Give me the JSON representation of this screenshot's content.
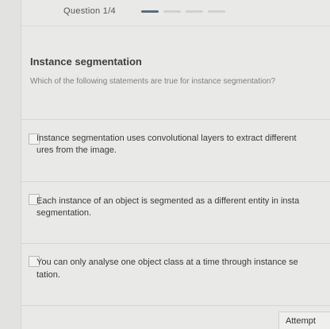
{
  "header": {
    "question_counter": "Question 1/4",
    "progress": {
      "total_steps": 4,
      "current_step": 1
    }
  },
  "content": {
    "title": "Instance segmentation",
    "question": "Which of the following statements are true for instance segmentation?"
  },
  "options": [
    {
      "line1": "Instance segmentation uses convolutional layers to extract different",
      "line2": "ures from the image.",
      "checked": false
    },
    {
      "line1": "Each instance of an object is segmented as a different entity in insta",
      "line2": "segmentation.",
      "checked": false
    },
    {
      "line1": "You can only analyse one object class at a time through instance se",
      "line2": "tation.",
      "checked": false
    }
  ],
  "footer": {
    "attempt_label": "Attempt"
  },
  "colors": {
    "background": "#e9e9e7",
    "progress_active": "#5b6b78",
    "progress_inactive": "#d0d0ce"
  }
}
